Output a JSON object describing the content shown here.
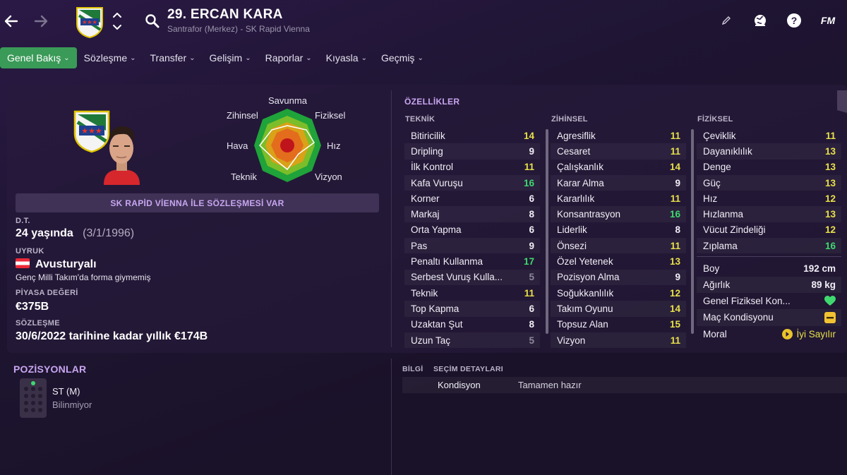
{
  "header": {
    "player_title": "29. ERCAN KARA",
    "player_subtitle": "Santrafor (Merkez) - SK Rapid Vienna",
    "fm_logo": "FM",
    "icons": [
      "back-arrow-icon",
      "forward-arrow-icon",
      "club-badge-icon",
      "up-down-icon",
      "search-icon",
      "edit-icon",
      "globe-icon",
      "help-icon"
    ]
  },
  "tabs": [
    {
      "label": "Genel Bakış",
      "active": true
    },
    {
      "label": "Sözleşme"
    },
    {
      "label": "Transfer"
    },
    {
      "label": "Gelişim"
    },
    {
      "label": "Raporlar"
    },
    {
      "label": "Kıyasla"
    },
    {
      "label": "Geçmiş"
    }
  ],
  "radar": {
    "labels": {
      "top": "Savunma",
      "top_left": "Zihinsel",
      "top_right": "Fiziksel",
      "left": "Hava",
      "right": "Hız",
      "bottom_left": "Teknik",
      "bottom_right": "Vizyon"
    }
  },
  "profile": {
    "contract_banner": "SK RAPİD VİENNA İLE SÖZLEŞMESİ VAR",
    "dob_label": "D.T.",
    "age": "24 yaşında",
    "dob": "(3/1/1996)",
    "nationality_label": "UYRUK",
    "nationality": "Avusturyalı",
    "international_note": "Genç Milli Takım'da forma giymemiş",
    "value_label": "PİYASA DEĞERİ",
    "value": "€375B",
    "contract_label": "SÖZLEŞME",
    "contract": "30/6/2022 tarihine kadar yıllık €174B"
  },
  "attributes": {
    "title": "ÖZELLİKLER",
    "colors": {
      "yellow": "#e8e04a",
      "green": "#3fd86f",
      "white": "#f1eef6",
      "gray": "#8e879c"
    },
    "technical": {
      "title": "TEKNİK",
      "items": [
        {
          "name": "Bitiricilik",
          "value": "14",
          "color": "#e8e04a"
        },
        {
          "name": "Dripling",
          "value": "9",
          "color": "#f1eef6"
        },
        {
          "name": "İlk Kontrol",
          "value": "11",
          "color": "#e8e04a"
        },
        {
          "name": "Kafa Vuruşu",
          "value": "16",
          "color": "#3fd86f"
        },
        {
          "name": "Korner",
          "value": "6",
          "color": "#f1eef6"
        },
        {
          "name": "Markaj",
          "value": "8",
          "color": "#f1eef6"
        },
        {
          "name": "Orta Yapma",
          "value": "6",
          "color": "#f1eef6"
        },
        {
          "name": "Pas",
          "value": "9",
          "color": "#f1eef6"
        },
        {
          "name": "Penaltı Kullanma",
          "value": "17",
          "color": "#3fd86f"
        },
        {
          "name": "Serbest Vuruş Kulla...",
          "value": "5",
          "color": "#8e879c"
        },
        {
          "name": "Teknik",
          "value": "11",
          "color": "#e8e04a"
        },
        {
          "name": "Top Kapma",
          "value": "6",
          "color": "#f1eef6"
        },
        {
          "name": "Uzaktan Şut",
          "value": "8",
          "color": "#f1eef6"
        },
        {
          "name": "Uzun Taç",
          "value": "5",
          "color": "#8e879c"
        }
      ]
    },
    "mental": {
      "title": "ZİHİNSEL",
      "items": [
        {
          "name": "Agresiflik",
          "value": "11",
          "color": "#e8e04a"
        },
        {
          "name": "Cesaret",
          "value": "11",
          "color": "#e8e04a"
        },
        {
          "name": "Çalışkanlık",
          "value": "14",
          "color": "#e8e04a"
        },
        {
          "name": "Karar Alma",
          "value": "9",
          "color": "#f1eef6"
        },
        {
          "name": "Kararlılık",
          "value": "11",
          "color": "#e8e04a"
        },
        {
          "name": "Konsantrasyon",
          "value": "16",
          "color": "#3fd86f"
        },
        {
          "name": "Liderlik",
          "value": "8",
          "color": "#f1eef6"
        },
        {
          "name": "Önsezi",
          "value": "11",
          "color": "#e8e04a"
        },
        {
          "name": "Özel Yetenek",
          "value": "13",
          "color": "#e8e04a"
        },
        {
          "name": "Pozisyon Alma",
          "value": "9",
          "color": "#f1eef6"
        },
        {
          "name": "Soğukkanlılık",
          "value": "12",
          "color": "#e8e04a"
        },
        {
          "name": "Takım Oyunu",
          "value": "14",
          "color": "#e8e04a"
        },
        {
          "name": "Topsuz Alan",
          "value": "15",
          "color": "#e8e04a"
        },
        {
          "name": "Vizyon",
          "value": "11",
          "color": "#e8e04a"
        }
      ]
    },
    "physical": {
      "title": "FİZİKSEL",
      "items": [
        {
          "name": "Çeviklik",
          "value": "11",
          "color": "#e8e04a"
        },
        {
          "name": "Dayanıklılık",
          "value": "13",
          "color": "#e8e04a"
        },
        {
          "name": "Denge",
          "value": "13",
          "color": "#e8e04a"
        },
        {
          "name": "Güç",
          "value": "13",
          "color": "#e8e04a"
        },
        {
          "name": "Hız",
          "value": "12",
          "color": "#e8e04a"
        },
        {
          "name": "Hızlanma",
          "value": "13",
          "color": "#e8e04a"
        },
        {
          "name": "Vücut Zindeliği",
          "value": "12",
          "color": "#e8e04a"
        },
        {
          "name": "Zıplama",
          "value": "16",
          "color": "#3fd86f"
        }
      ]
    },
    "extra": {
      "height_label": "Boy",
      "height": "192 cm",
      "weight_label": "Ağırlık",
      "weight": "89 kg",
      "fitness_label": "Genel Fiziksel Kon...",
      "condition_label": "Maç Kondisyonu",
      "morale_label": "Moral",
      "morale": "İyi Sayılır"
    }
  },
  "positions": {
    "title": "POZİSYONLAR",
    "position": "ST (M)",
    "familiarity": "Bilinmiyor"
  },
  "bottom_right": {
    "tab_info": "BİLGİ",
    "tab_selection": "SEÇİM DETAYLARI",
    "condition_label": "Kondisyon",
    "condition_value": "Tamamen hazır"
  }
}
